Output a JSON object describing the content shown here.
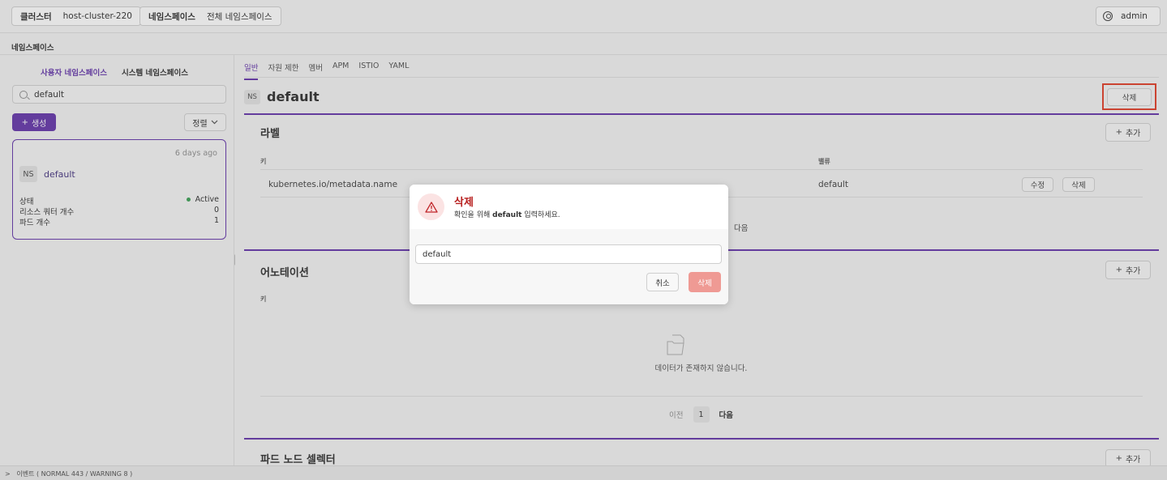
{
  "topbar": {
    "cluster_label": "클러스터",
    "cluster_value": "host-cluster-220",
    "namespace_label": "네임스페이스",
    "namespace_value": "전체 네임스페이스",
    "user": "admin"
  },
  "breadcrumb": "네임스페이스",
  "left": {
    "tabs": [
      {
        "label": "사용자 네임스페이스",
        "active": true
      },
      {
        "label": "시스템 네임스페이스",
        "active": false
      }
    ],
    "search_value": "default",
    "create_label": "생성",
    "sort_label": "정렬",
    "card": {
      "age": "6 days ago",
      "badge": "NS",
      "name": "default",
      "rows": [
        {
          "label": "상태",
          "value": "Active"
        },
        {
          "label": "리소스 쿼터 개수",
          "value": "0"
        },
        {
          "label": "파드 개수",
          "value": "1"
        }
      ]
    }
  },
  "main": {
    "tabs": [
      "일반",
      "자원 제한",
      "멤버",
      "APM",
      "ISTIO",
      "YAML"
    ],
    "active_tab": "일반",
    "ns_badge": "NS",
    "ns_name": "default",
    "delete_label": "삭제",
    "labels_section": {
      "title": "라벨",
      "add_label": "추가",
      "col_key": "키",
      "col_value": "밸류",
      "row": {
        "key": "kubernetes.io/metadata.name",
        "value": "default",
        "edit_label": "수정",
        "delete_label": "삭제"
      },
      "pager_next_partial": "다음"
    },
    "annotations_section": {
      "title": "어노테이션",
      "add_label": "추가",
      "col_key": "키",
      "empty_text": "데이터가 존재하지 않습니다.",
      "pager_prev": "이전",
      "pager_page": "1",
      "pager_next": "다음"
    },
    "pod_selector_section": {
      "title": "파드 노드 셀렉터",
      "add_label": "추가"
    }
  },
  "modal": {
    "title": "삭제",
    "desc_prefix": "확인을 위해",
    "desc_target": "default",
    "desc_suffix": "입력하세요.",
    "input_value": "default",
    "cancel_label": "취소",
    "confirm_label": "삭제"
  },
  "bottombar": {
    "text": "이벤트 ( NORMAL 443 / WARNING 8 )"
  },
  "colors": {
    "accent": "#5b2aa6",
    "danger": "#b8201f",
    "danger_button": "#ef9a94",
    "highlight_box": "#e0321c",
    "status_active": "#2f9a4a"
  },
  "icons": [
    "user-icon",
    "search-icon",
    "plus-icon",
    "chevron-down-icon",
    "warning-icon",
    "empty-folder-icon",
    "chevron-right-icon"
  ]
}
